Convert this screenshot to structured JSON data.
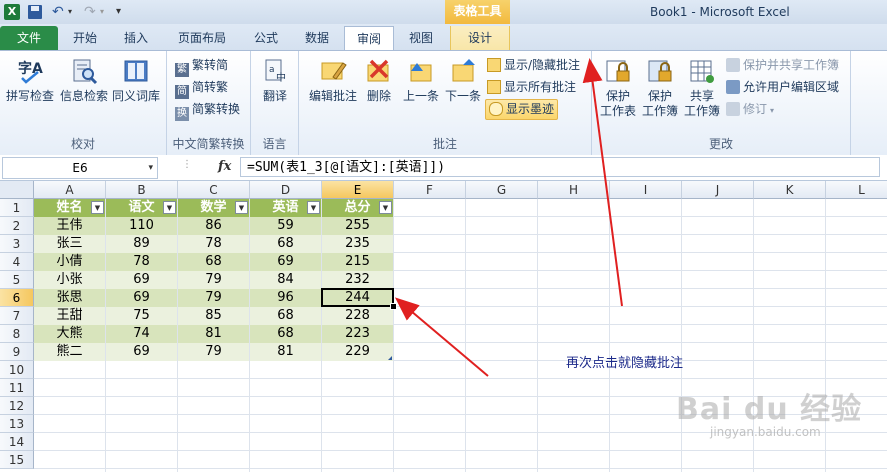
{
  "titlebar": {
    "app_icon": "X",
    "contextual_tab_group": "表格工具",
    "window_title": "Book1  -  Microsoft Excel",
    "icons": [
      "excel-app-icon",
      "save-icon",
      "undo-icon",
      "redo-icon",
      "customize-qat-icon"
    ]
  },
  "tabs": {
    "file": "文件",
    "home": "开始",
    "insert": "插入",
    "page_layout": "页面布局",
    "formulas": "公式",
    "data": "数据",
    "review": "审阅",
    "view": "视图",
    "design": "设计",
    "active": "审阅"
  },
  "ribbon": {
    "proofing": {
      "label": "校对",
      "spelling": "拼写检查",
      "research": "信息检索",
      "thesaurus": "同义词库"
    },
    "chinese_conversion": {
      "label": "中文简繁转换",
      "to_simplified": "繁转简",
      "to_traditional": "简转繁",
      "convert": "简繁转换"
    },
    "language": {
      "label": "语言",
      "translate": "翻译"
    },
    "comments": {
      "label": "批注",
      "edit": "编辑批注",
      "delete": "删除",
      "previous": "上一条",
      "next": "下一条",
      "show_hide": "显示/隐藏批注",
      "show_all": "显示所有批注",
      "show_ink": "显示墨迹"
    },
    "changes": {
      "label": "更改",
      "protect_sheet": "保护\n工作表",
      "protect_workbook": "保护\n工作簿",
      "share_workbook": "共享\n工作簿",
      "protect_share": "保护并共享工作簿",
      "allow_edit_ranges": "允许用户编辑区域",
      "track_changes": "修订"
    }
  },
  "formula_bar": {
    "name_box": "E6",
    "fx": "fx",
    "formula": "=SUM(表1_3[@[语文]:[英语]])"
  },
  "grid": {
    "columns": [
      "A",
      "B",
      "C",
      "D",
      "E",
      "F",
      "G",
      "H",
      "I",
      "J",
      "K",
      "L"
    ],
    "rows": [
      "1",
      "2",
      "3",
      "4",
      "5",
      "6",
      "7",
      "8",
      "9",
      "10",
      "11",
      "12",
      "13",
      "14",
      "15"
    ],
    "selected_column": "E",
    "selected_row": "6"
  },
  "table": {
    "headers": [
      "姓名",
      "语文",
      "数学",
      "英语",
      "总分"
    ],
    "rows": [
      [
        "王伟",
        "110",
        "86",
        "59",
        "255"
      ],
      [
        "张三",
        "89",
        "78",
        "68",
        "235"
      ],
      [
        "小倩",
        "78",
        "68",
        "69",
        "215"
      ],
      [
        "小张",
        "69",
        "79",
        "84",
        "232"
      ],
      [
        "张思",
        "69",
        "79",
        "96",
        "244"
      ],
      [
        "王甜",
        "75",
        "85",
        "68",
        "228"
      ],
      [
        "大熊",
        "74",
        "81",
        "68",
        "223"
      ],
      [
        "熊二",
        "69",
        "79",
        "81",
        "229"
      ]
    ],
    "header_color": "#9bbb59",
    "band_color": "#d8e4bc",
    "alt_color": "#ebf1de"
  },
  "annotation": {
    "text": "再次点击就隐藏批注",
    "arrow_color": "#e02020"
  },
  "watermark": {
    "logo": "Bai du 经验",
    "url": "jingyan.baidu.com"
  }
}
